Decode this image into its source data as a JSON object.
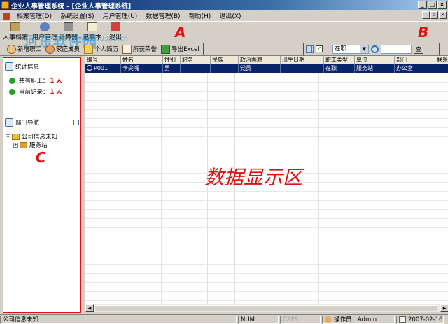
{
  "window": {
    "title": "企业人事管理系统 - [企业人事管理系统]",
    "minimize": "_",
    "maximize": "□",
    "close": "×"
  },
  "menubar": {
    "items": [
      "档案管理(D)",
      "系统设置(S)",
      "用户管理(U)",
      "数据管理(B)",
      "帮助(H)",
      "退出(X)"
    ],
    "mdi_min": "_",
    "mdi_restore": "▫",
    "mdi_close": "×"
  },
  "bigtoolbar": {
    "items": [
      "人事档案",
      "用户管理",
      "计算器",
      "记事本",
      "退出"
    ],
    "watermark": "河东软件园",
    "watermark_url": "www.pc0359.cn"
  },
  "toolbar": {
    "buttons": [
      "新增职工",
      "家庭成员",
      "个人简历",
      "所获荣誉",
      "导出Excel"
    ],
    "filter_value": "在职",
    "query_label": "查"
  },
  "labels": {
    "A": "A",
    "B": "B",
    "C": "C",
    "display_area": "数据显示区"
  },
  "leftpanel": {
    "stats_title": "统计信息",
    "total_label": "共有职工：",
    "total_value": "1 人",
    "current_label": "当前记录：",
    "current_value": "1 人",
    "nav_title": "部门导航",
    "tree_root": "公司信息未知",
    "tree_child": "服务站"
  },
  "grid": {
    "columns": [
      "编号",
      "姓名",
      "性别",
      "职务",
      "民族",
      "政治面貌",
      "出生日期",
      "职工类型",
      "单位",
      "部门",
      "联系"
    ],
    "rows": [
      [
        "P001",
        "李尖嘴",
        "男",
        "",
        "",
        "党员",
        "",
        "在职",
        "服务站",
        "办公室",
        ""
      ]
    ]
  },
  "statusbar": {
    "company": "公司信息未知",
    "num": "NUM",
    "caps": "CAPS",
    "operator": "操作员：Admin",
    "date": "2007-02-16"
  }
}
